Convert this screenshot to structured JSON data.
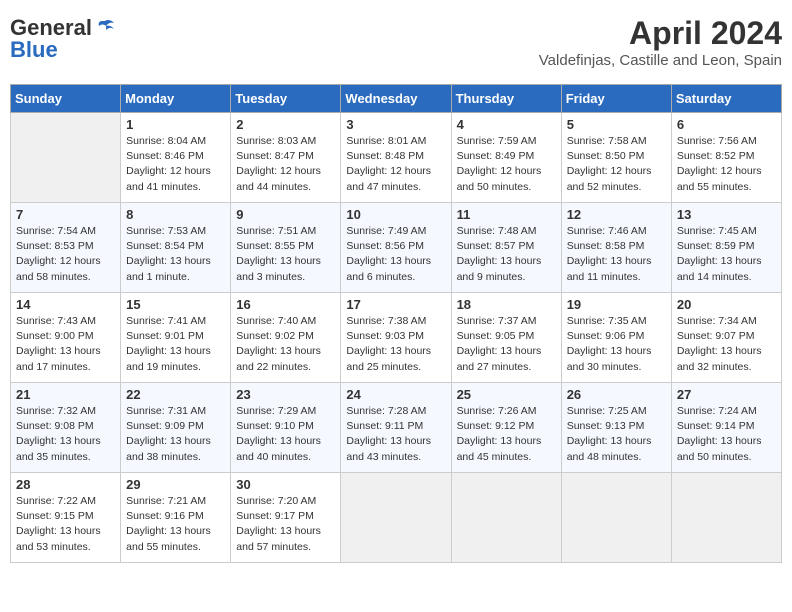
{
  "header": {
    "logo_line1": "General",
    "logo_line2": "Blue",
    "month_title": "April 2024",
    "location": "Valdefinjas, Castille and Leon, Spain"
  },
  "days_of_week": [
    "Sunday",
    "Monday",
    "Tuesday",
    "Wednesday",
    "Thursday",
    "Friday",
    "Saturday"
  ],
  "weeks": [
    [
      {
        "day": "",
        "content": ""
      },
      {
        "day": "1",
        "content": "Sunrise: 8:04 AM\nSunset: 8:46 PM\nDaylight: 12 hours\nand 41 minutes."
      },
      {
        "day": "2",
        "content": "Sunrise: 8:03 AM\nSunset: 8:47 PM\nDaylight: 12 hours\nand 44 minutes."
      },
      {
        "day": "3",
        "content": "Sunrise: 8:01 AM\nSunset: 8:48 PM\nDaylight: 12 hours\nand 47 minutes."
      },
      {
        "day": "4",
        "content": "Sunrise: 7:59 AM\nSunset: 8:49 PM\nDaylight: 12 hours\nand 50 minutes."
      },
      {
        "day": "5",
        "content": "Sunrise: 7:58 AM\nSunset: 8:50 PM\nDaylight: 12 hours\nand 52 minutes."
      },
      {
        "day": "6",
        "content": "Sunrise: 7:56 AM\nSunset: 8:52 PM\nDaylight: 12 hours\nand 55 minutes."
      }
    ],
    [
      {
        "day": "7",
        "content": "Sunrise: 7:54 AM\nSunset: 8:53 PM\nDaylight: 12 hours\nand 58 minutes."
      },
      {
        "day": "8",
        "content": "Sunrise: 7:53 AM\nSunset: 8:54 PM\nDaylight: 13 hours\nand 1 minute."
      },
      {
        "day": "9",
        "content": "Sunrise: 7:51 AM\nSunset: 8:55 PM\nDaylight: 13 hours\nand 3 minutes."
      },
      {
        "day": "10",
        "content": "Sunrise: 7:49 AM\nSunset: 8:56 PM\nDaylight: 13 hours\nand 6 minutes."
      },
      {
        "day": "11",
        "content": "Sunrise: 7:48 AM\nSunset: 8:57 PM\nDaylight: 13 hours\nand 9 minutes."
      },
      {
        "day": "12",
        "content": "Sunrise: 7:46 AM\nSunset: 8:58 PM\nDaylight: 13 hours\nand 11 minutes."
      },
      {
        "day": "13",
        "content": "Sunrise: 7:45 AM\nSunset: 8:59 PM\nDaylight: 13 hours\nand 14 minutes."
      }
    ],
    [
      {
        "day": "14",
        "content": "Sunrise: 7:43 AM\nSunset: 9:00 PM\nDaylight: 13 hours\nand 17 minutes."
      },
      {
        "day": "15",
        "content": "Sunrise: 7:41 AM\nSunset: 9:01 PM\nDaylight: 13 hours\nand 19 minutes."
      },
      {
        "day": "16",
        "content": "Sunrise: 7:40 AM\nSunset: 9:02 PM\nDaylight: 13 hours\nand 22 minutes."
      },
      {
        "day": "17",
        "content": "Sunrise: 7:38 AM\nSunset: 9:03 PM\nDaylight: 13 hours\nand 25 minutes."
      },
      {
        "day": "18",
        "content": "Sunrise: 7:37 AM\nSunset: 9:05 PM\nDaylight: 13 hours\nand 27 minutes."
      },
      {
        "day": "19",
        "content": "Sunrise: 7:35 AM\nSunset: 9:06 PM\nDaylight: 13 hours\nand 30 minutes."
      },
      {
        "day": "20",
        "content": "Sunrise: 7:34 AM\nSunset: 9:07 PM\nDaylight: 13 hours\nand 32 minutes."
      }
    ],
    [
      {
        "day": "21",
        "content": "Sunrise: 7:32 AM\nSunset: 9:08 PM\nDaylight: 13 hours\nand 35 minutes."
      },
      {
        "day": "22",
        "content": "Sunrise: 7:31 AM\nSunset: 9:09 PM\nDaylight: 13 hours\nand 38 minutes."
      },
      {
        "day": "23",
        "content": "Sunrise: 7:29 AM\nSunset: 9:10 PM\nDaylight: 13 hours\nand 40 minutes."
      },
      {
        "day": "24",
        "content": "Sunrise: 7:28 AM\nSunset: 9:11 PM\nDaylight: 13 hours\nand 43 minutes."
      },
      {
        "day": "25",
        "content": "Sunrise: 7:26 AM\nSunset: 9:12 PM\nDaylight: 13 hours\nand 45 minutes."
      },
      {
        "day": "26",
        "content": "Sunrise: 7:25 AM\nSunset: 9:13 PM\nDaylight: 13 hours\nand 48 minutes."
      },
      {
        "day": "27",
        "content": "Sunrise: 7:24 AM\nSunset: 9:14 PM\nDaylight: 13 hours\nand 50 minutes."
      }
    ],
    [
      {
        "day": "28",
        "content": "Sunrise: 7:22 AM\nSunset: 9:15 PM\nDaylight: 13 hours\nand 53 minutes."
      },
      {
        "day": "29",
        "content": "Sunrise: 7:21 AM\nSunset: 9:16 PM\nDaylight: 13 hours\nand 55 minutes."
      },
      {
        "day": "30",
        "content": "Sunrise: 7:20 AM\nSunset: 9:17 PM\nDaylight: 13 hours\nand 57 minutes."
      },
      {
        "day": "",
        "content": ""
      },
      {
        "day": "",
        "content": ""
      },
      {
        "day": "",
        "content": ""
      },
      {
        "day": "",
        "content": ""
      }
    ]
  ]
}
